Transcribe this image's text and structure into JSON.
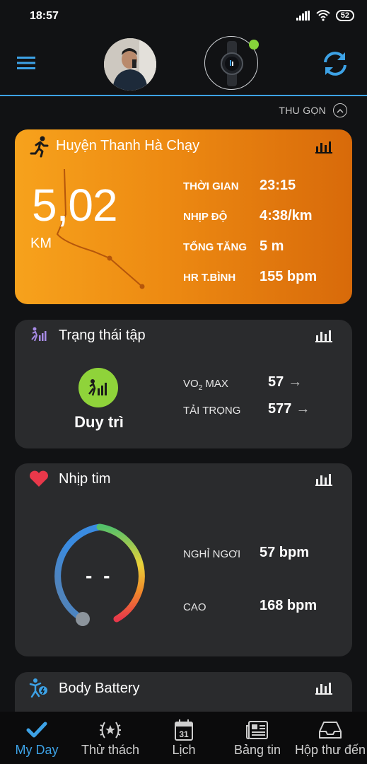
{
  "status_bar": {
    "time": "18:57",
    "battery": "52"
  },
  "collapse": {
    "label": "THU GỌN"
  },
  "activity": {
    "title": "Huyện Thanh Hà Chạy",
    "distance": "5,02",
    "distance_unit": "KM",
    "metrics": [
      {
        "label": "THỜI GIAN",
        "value": "23:15"
      },
      {
        "label": "NHỊP ĐỘ",
        "value": "4:38/km"
      },
      {
        "label": "TỔNG TĂNG",
        "value": "5 m"
      },
      {
        "label": "HR T.BÌNH",
        "value": "155 bpm"
      }
    ]
  },
  "training": {
    "title": "Trạng thái tập",
    "status": "Duy trì",
    "vo2_label_main": "VO",
    "vo2_label_sub": "2",
    "vo2_label_end": " MAX",
    "vo2_value": "57",
    "load_label": "TẢI TRỌNG",
    "load_value": "577",
    "arrow": "→"
  },
  "heart_rate": {
    "title": "Nhịp tim",
    "current": "- -",
    "resting_label": "NGHỈ NGƠI",
    "resting_value": "57 bpm",
    "high_label": "CAO",
    "high_value": "168 bpm"
  },
  "body_battery": {
    "title": "Body Battery"
  },
  "tabs": [
    {
      "label": "My Day",
      "icon": "checkmark-icon"
    },
    {
      "label": "Thử thách",
      "icon": "laurel-icon"
    },
    {
      "label": "Lịch",
      "icon": "calendar-icon",
      "calendar_day": "31"
    },
    {
      "label": "Bảng tin",
      "icon": "news-icon"
    },
    {
      "label": "Hộp thư đến",
      "icon": "inbox-icon"
    }
  ],
  "colors": {
    "accent": "#3da2e6",
    "activity_orange": "#ed8a12",
    "status_green": "#8fd33a",
    "heart_red": "#e8384a"
  }
}
